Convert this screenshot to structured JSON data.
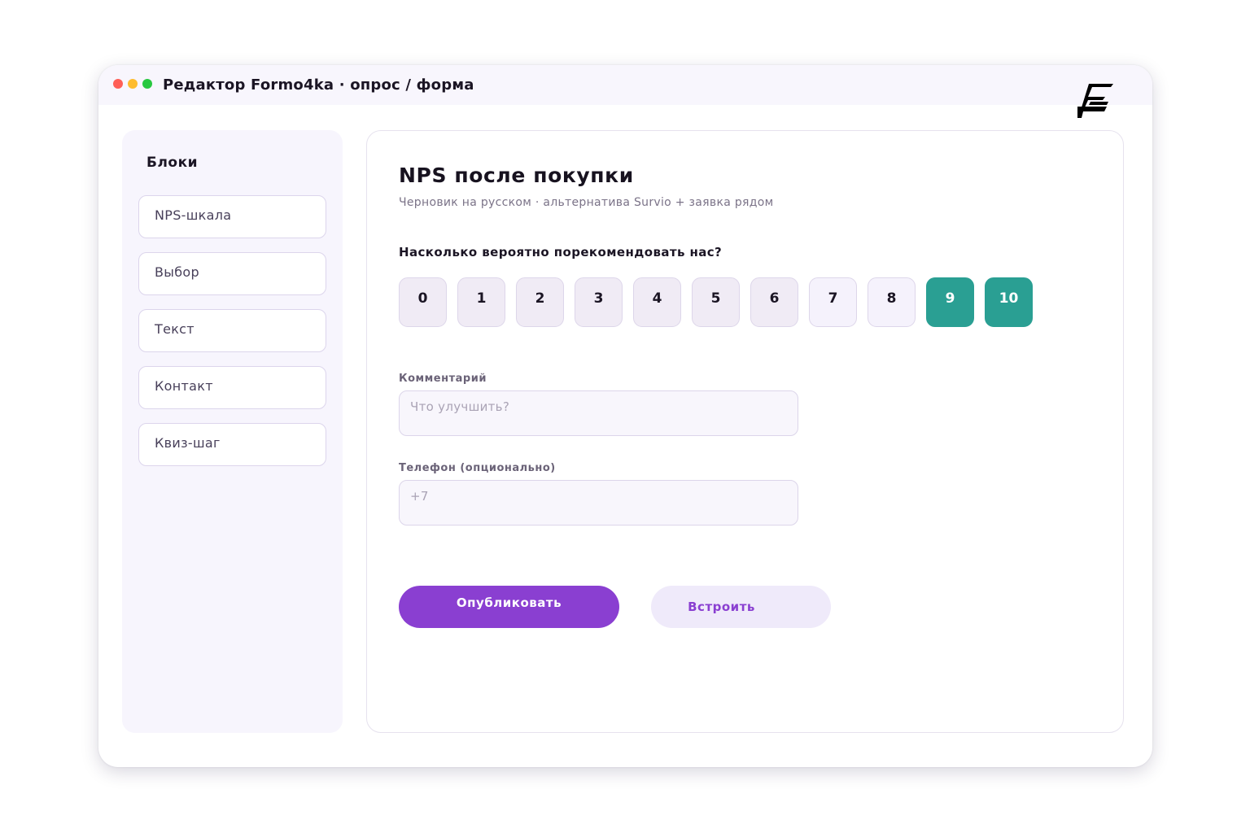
{
  "window": {
    "title": "Редактор Formo4ka · опрос / форма",
    "controls": {
      "close_color": "#ff5f57",
      "minimize_color": "#febc2e",
      "maximize_color": "#28c840"
    },
    "logo_icon": "formo4ka-logo-icon"
  },
  "sidebar": {
    "title": "Блоки",
    "items": [
      {
        "label": "NPS-шкала"
      },
      {
        "label": "Выбор"
      },
      {
        "label": "Текст"
      },
      {
        "label": "Контакт"
      },
      {
        "label": "Квиз-шаг"
      }
    ]
  },
  "form": {
    "title": "NPS после покупки",
    "subtitle": "Черновик на русском · альтернатива Survio + заявка рядом",
    "question": "Насколько вероятно порекомендовать нас?",
    "scale": {
      "values": [
        "0",
        "1",
        "2",
        "3",
        "4",
        "5",
        "6",
        "7",
        "8",
        "9",
        "10"
      ],
      "highlighted": [
        "9",
        "10"
      ],
      "colors": {
        "detractor": "#f0ebf5",
        "passive": "#f5f2fc",
        "promoter": "#2a9f93"
      }
    },
    "comment": {
      "label": "Комментарий",
      "placeholder": "Что улучшить?",
      "value": ""
    },
    "phone": {
      "label": "Телефон (опционально)",
      "placeholder": "+7",
      "value": ""
    },
    "actions": {
      "publish_label": "Опубликовать",
      "embed_label": "Встроить"
    }
  },
  "colors": {
    "accent": "#8a3fd1",
    "accent_soft": "#efeafa",
    "teal": "#2a9f93"
  }
}
